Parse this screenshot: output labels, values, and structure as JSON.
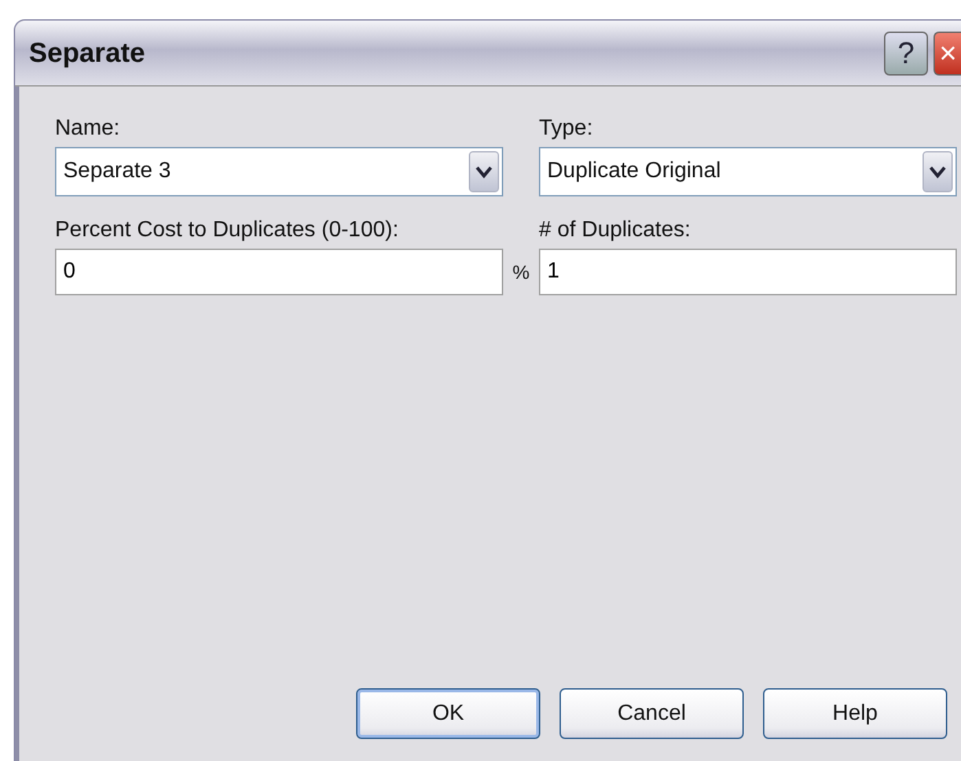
{
  "window": {
    "title": "Separate",
    "help_button": "?",
    "close_button": "×"
  },
  "fields": [
    {
      "label": "Name:",
      "kind": "combo",
      "value": "Separate 3"
    },
    {
      "label": "Type:",
      "kind": "combo",
      "value": "Duplicate Original"
    },
    {
      "label": "Percent Cost to Duplicates (0-100):",
      "kind": "text",
      "value": "0",
      "suffix": "%"
    },
    {
      "label": "# of Duplicates:",
      "kind": "text",
      "value": "1"
    }
  ],
  "buttons": [
    {
      "label": "OK",
      "default": true
    },
    {
      "label": "Cancel",
      "default": false
    },
    {
      "label": "Help",
      "default": false
    }
  ]
}
